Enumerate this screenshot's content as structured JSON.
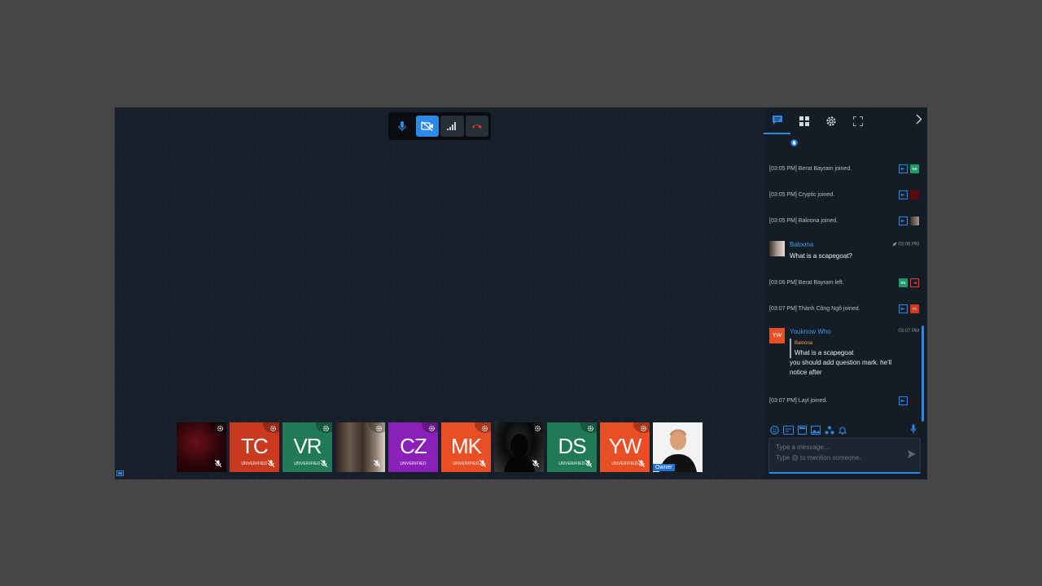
{
  "controls": {
    "items": [
      "microphone-icon",
      "camera-off-icon",
      "signal-icon",
      "hangup-icon"
    ],
    "accent": "#2a8ae6",
    "hangup_color": "#e03c31"
  },
  "participants": [
    {
      "initials": "",
      "kind": "photo-dark-red",
      "badge": ""
    },
    {
      "initials": "TC",
      "color": "#c93a1e",
      "badge": "UNVERIFIED"
    },
    {
      "initials": "VR",
      "color": "#1f7a55",
      "badge": "UNVERIFIED"
    },
    {
      "initials": "",
      "kind": "photo-hair",
      "badge": ""
    },
    {
      "initials": "CZ",
      "color": "#8a20b8",
      "badge": "UNVERIFIED"
    },
    {
      "initials": "MK",
      "color": "#e94e24",
      "badge": "UNVERIFIED"
    },
    {
      "initials": "",
      "kind": "photo-silhouette",
      "badge": ""
    },
    {
      "initials": "DS",
      "color": "#1f7a55",
      "badge": "UNVERIFIED"
    },
    {
      "initials": "YW",
      "color": "#e94e24",
      "badge": "UNVERIFIED"
    },
    {
      "initials": "",
      "kind": "photo-owner",
      "badge": "Owner"
    }
  ],
  "sidebar": {
    "tabs": [
      "chat-icon",
      "grid-icon",
      "gear-icon",
      "fullscreen-icon"
    ],
    "collapse_icon": "chevron-right-icon"
  },
  "chat": {
    "system": [
      {
        "text": "[03:05 PM] Berat Bayram joined.",
        "av": "BB",
        "av_color": "#1f9a6a",
        "type": "join"
      },
      {
        "text": "[03:05 PM] Cryptic joined.",
        "av": "",
        "av_color": "#5a0a0a",
        "type": "join"
      },
      {
        "text": "[03:05 PM] Baloona joined.",
        "av": "",
        "av_color": "#7a6a5a",
        "type": "join"
      },
      {
        "text": "[03:06 PM] Berat Bayram left.",
        "av": "BB",
        "av_color": "#1f9a6a",
        "type": "leave"
      },
      {
        "text": "[03:07 PM] Thành Công Ngô joined.",
        "av": "TC",
        "av_color": "#c93a1e",
        "type": "join"
      },
      {
        "text": "[03:07 PM] Layl joined.",
        "av": "",
        "av_color": "#1a1a1a",
        "type": "join"
      }
    ],
    "msg1": {
      "name": "Baloona",
      "time": "03:06 PM",
      "text": "What is a scapegoat?"
    },
    "msg2": {
      "name": "Youknow Who",
      "initials": "YW",
      "time": "03:07 PM",
      "quote_name": "Baloona",
      "quote_text": "What is a scapegoat",
      "text": "you should add question mark. he'll notice after"
    }
  },
  "composer": {
    "placeholder_line1": "Type a message...",
    "placeholder_line2": "Type @ to mention someone.",
    "tools": [
      "emoji-icon",
      "sticker-icon",
      "gif-icon",
      "image-icon",
      "share-icon",
      "bell-icon"
    ]
  }
}
